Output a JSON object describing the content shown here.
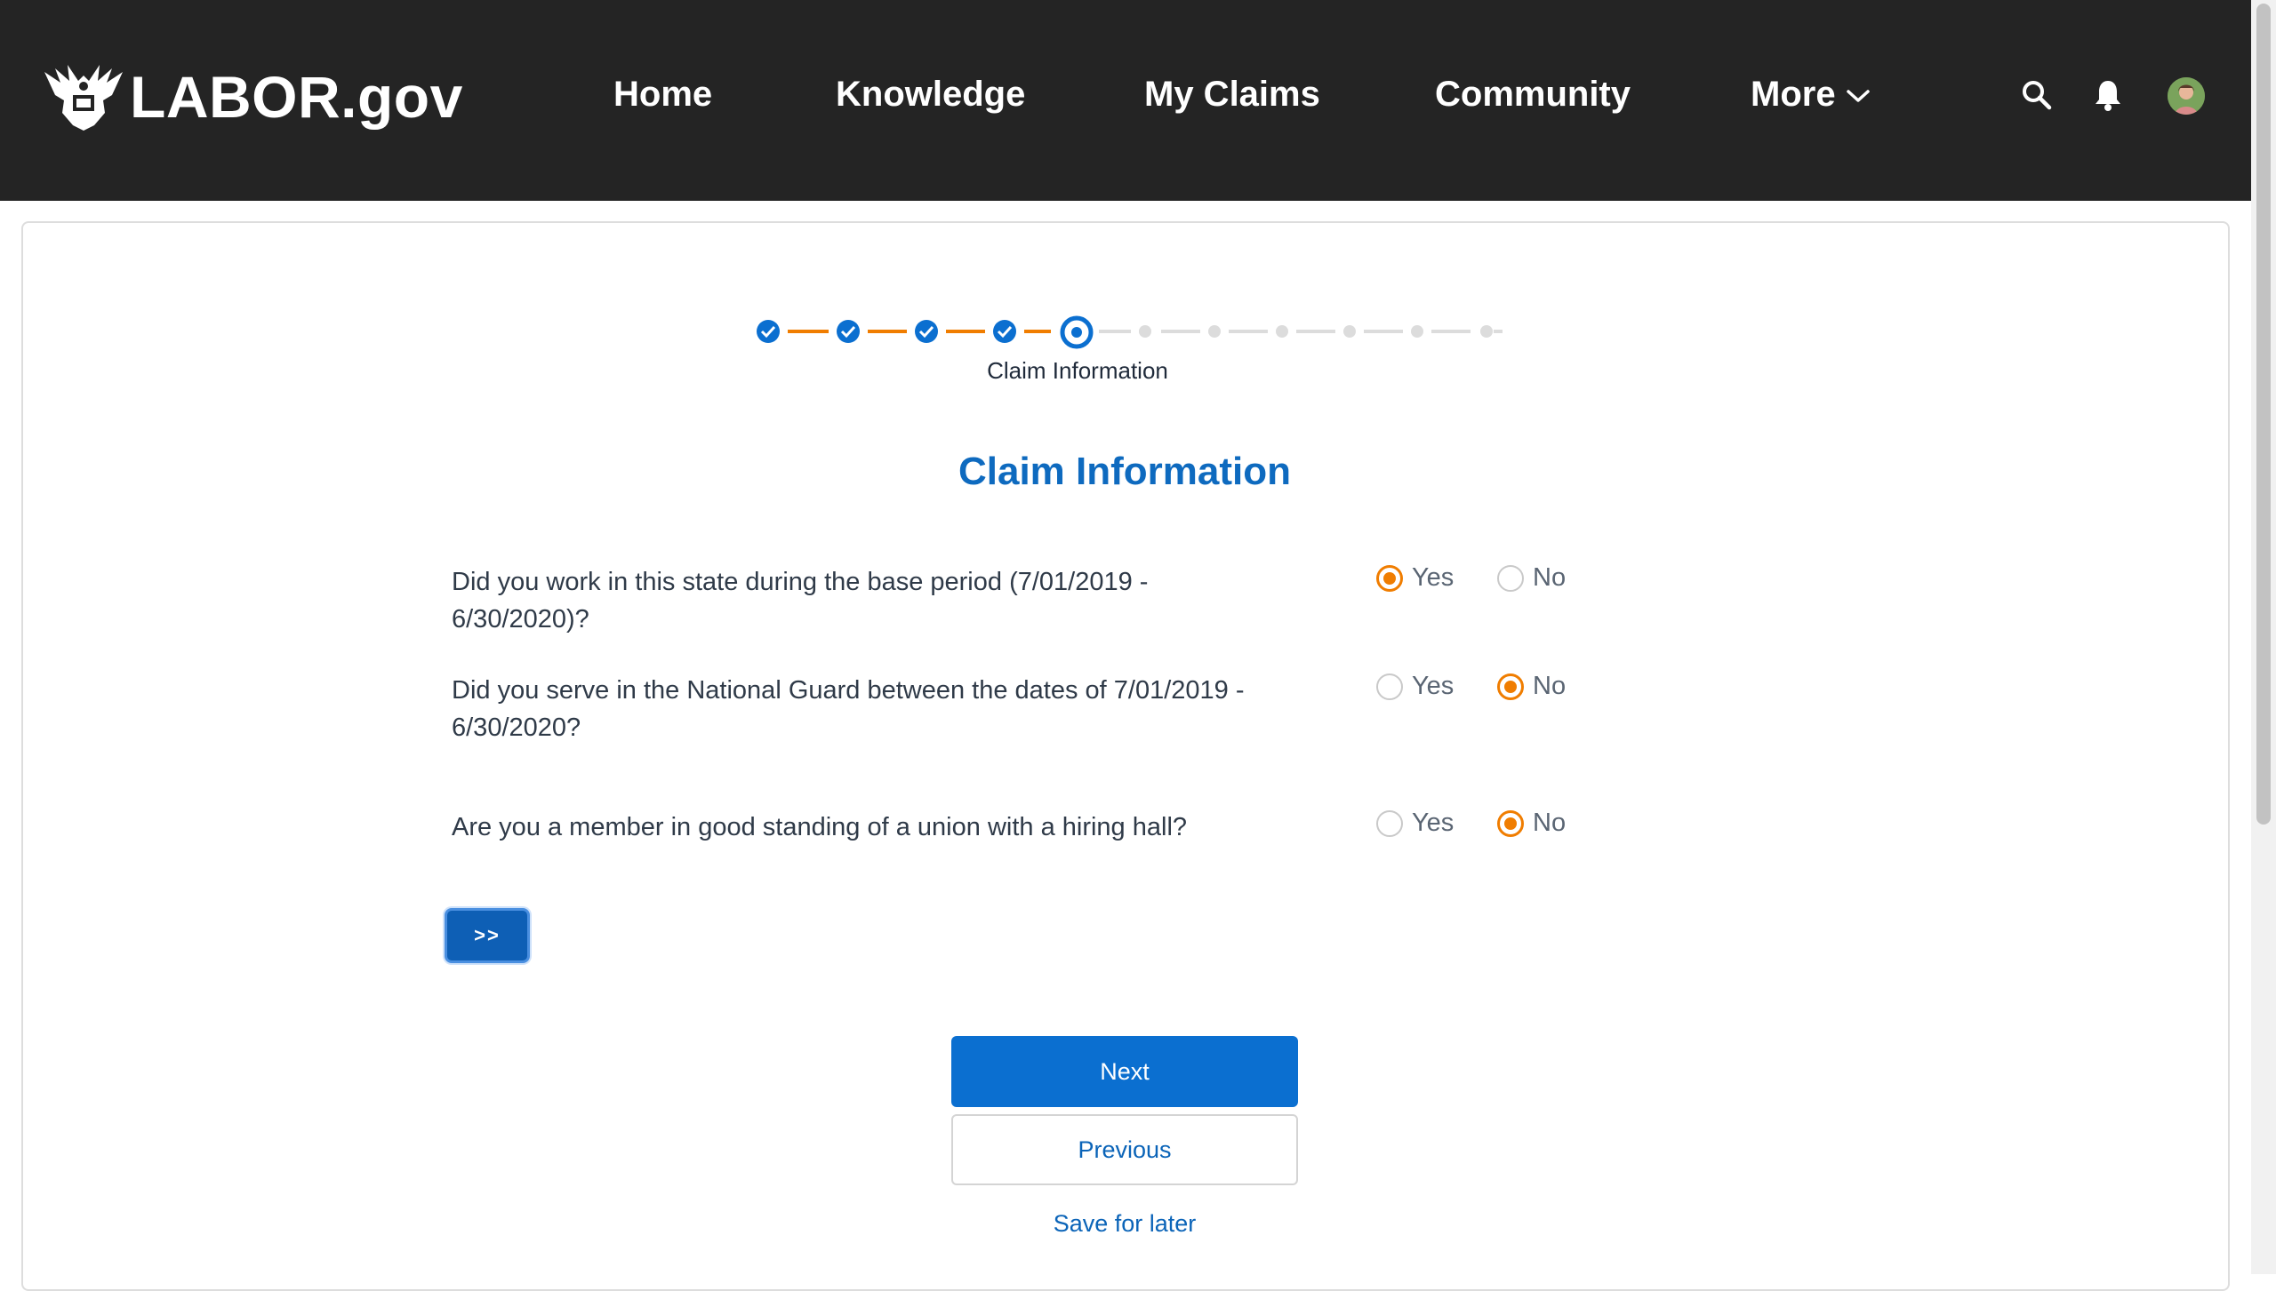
{
  "colors": {
    "header_bg": "#242424",
    "brand_blue": "#0e6abf",
    "accent_orange": "#f07d00",
    "button_blue": "#0b6fd0"
  },
  "header": {
    "logo_text": "LABOR.gov",
    "nav": [
      {
        "label": "Home"
      },
      {
        "label": "Knowledge"
      },
      {
        "label": "My Claims"
      },
      {
        "label": "Community"
      },
      {
        "label": "More",
        "icon": "chevron-down-icon"
      }
    ],
    "icons": [
      "search-icon",
      "bell-icon",
      "avatar"
    ]
  },
  "progress": {
    "total_steps": 10,
    "completed_steps": 4,
    "current_step": 5,
    "current_label": "Claim Information"
  },
  "form": {
    "title": "Claim Information",
    "option_yes": "Yes",
    "option_no": "No",
    "questions": [
      {
        "text": "Did you work in this state during the base period (7/01/2019 - 6/30/2020)?",
        "selected": "Yes"
      },
      {
        "text": "Did you serve in the National Guard between the dates of 7/01/2019 - 6/30/2020?",
        "selected": "No"
      },
      {
        "text": "Are you a member in good standing of a union with a hiring hall?",
        "selected": "No"
      }
    ],
    "skip_label": ">>",
    "next_label": "Next",
    "previous_label": "Previous",
    "save_label": "Save for later"
  }
}
